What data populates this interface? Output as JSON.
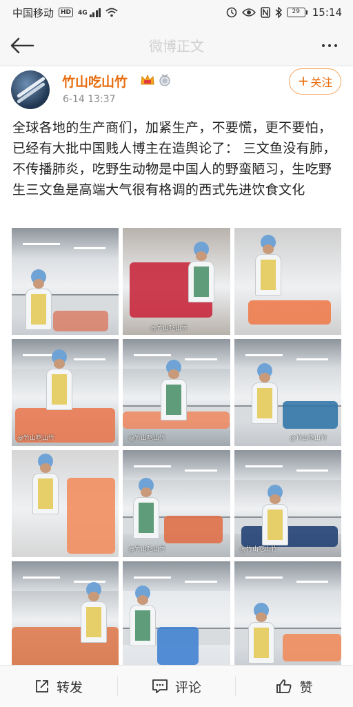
{
  "status_bar": {
    "carrier": "中国移动",
    "hd_badge": "HD",
    "network": "4G",
    "battery": "29",
    "time": "15:14"
  },
  "nav": {
    "title": "微博正文"
  },
  "post": {
    "author": "竹山吃山竹",
    "time": "6-14 13:37",
    "follow_label": "关注",
    "follow_plus": "+",
    "text": "全球各地的生产商们，加紧生产，不要慌，更不要怕，已经有大批中国贱人博主在造舆论了： 三文鱼没有肺，不传播肺炎，吃野生动物是中国人的野蛮陋习，生吃野生三文鱼是高端大气很有格调的西式先进饮食文化",
    "watermark": "@竹山吃山竹",
    "photos": [
      {
        "name": "photo-1",
        "bg": "#c9ccd1",
        "accent": "#d9826b"
      },
      {
        "name": "photo-2",
        "bg": "#b8b2ac",
        "accent": "#c8243a"
      },
      {
        "name": "photo-3",
        "bg": "#cfcfcf",
        "accent": "#f07a4a"
      },
      {
        "name": "photo-4",
        "bg": "#b7bcc0",
        "accent": "#e9774f"
      },
      {
        "name": "photo-5",
        "bg": "#9fa8ae",
        "accent": "#ee8a63"
      },
      {
        "name": "photo-6",
        "bg": "#c3c7cb",
        "accent": "#2f74a8"
      },
      {
        "name": "photo-7",
        "bg": "#d6d6d6",
        "accent": "#f28c5c"
      },
      {
        "name": "photo-8",
        "bg": "#b3b9bd",
        "accent": "#e06d46"
      },
      {
        "name": "photo-9",
        "bg": "#a7abb0",
        "accent": "#1f3f73"
      },
      {
        "name": "photo-10",
        "bg": "#9da3a8",
        "accent": "#e07a4c"
      },
      {
        "name": "photo-11",
        "bg": "#dfe3e7",
        "accent": "#3d7fd0"
      },
      {
        "name": "photo-12",
        "bg": "#c7ccd2",
        "accent": "#f08a5a"
      }
    ]
  },
  "actions": {
    "repost": "转发",
    "comment": "评论",
    "like": "赞"
  },
  "colors": {
    "accent": "#e86b0c",
    "follow_border": "#f3a35c"
  }
}
